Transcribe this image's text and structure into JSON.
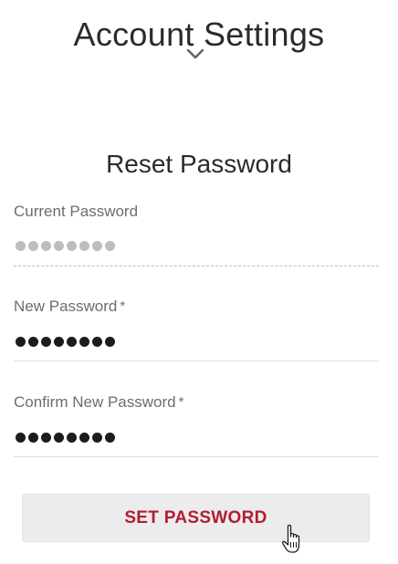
{
  "header": {
    "title": "Account Settings",
    "chevron_icon": "chevron-down-icon"
  },
  "reset_section": {
    "title": "Reset Password",
    "fields": [
      {
        "label": "Current Password",
        "required": false,
        "disabled": true,
        "masked_value_length": 8
      },
      {
        "label": "New Password",
        "required": true,
        "required_mark": "*",
        "disabled": false,
        "masked_value_length": 8
      },
      {
        "label": "Confirm New Password",
        "required": true,
        "required_mark": "*",
        "disabled": false,
        "masked_value_length": 8
      }
    ],
    "submit_label": "SET PASSWORD"
  },
  "colors": {
    "accent": "#b21d2f",
    "button_background": "#ececec",
    "label": "#6d6d6d",
    "disabled_dot": "#bdbdbd"
  },
  "cursor_icon": "hand-pointer-icon"
}
